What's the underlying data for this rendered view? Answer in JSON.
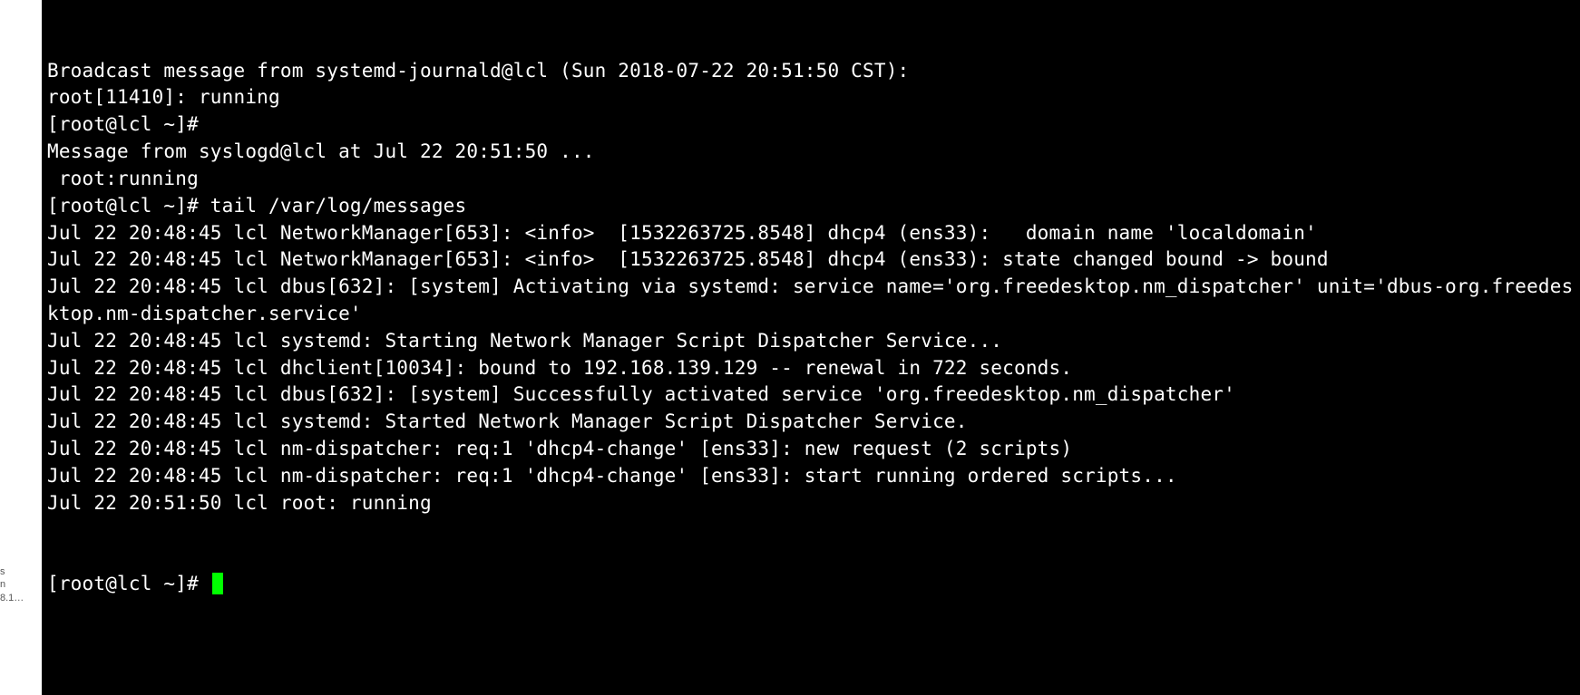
{
  "sidebar": {
    "fragment": "s\nn\n8.1…"
  },
  "terminal": {
    "lines": [
      "Broadcast message from systemd-journald@lcl (Sun 2018-07-22 20:51:50 CST):",
      "",
      "root[11410]: running",
      "",
      "[root@lcl ~]#",
      "Message from syslogd@lcl at Jul 22 20:51:50 ...",
      " root:running",
      "",
      "[root@lcl ~]# tail /var/log/messages",
      "Jul 22 20:48:45 lcl NetworkManager[653]: <info>  [1532263725.8548] dhcp4 (ens33):   domain name 'localdomain'",
      "Jul 22 20:48:45 lcl NetworkManager[653]: <info>  [1532263725.8548] dhcp4 (ens33): state changed bound -> bound",
      "Jul 22 20:48:45 lcl dbus[632]: [system] Activating via systemd: service name='org.freedesktop.nm_dispatcher' unit='dbus-org.freedesktop.nm-dispatcher.service'",
      "Jul 22 20:48:45 lcl systemd: Starting Network Manager Script Dispatcher Service...",
      "Jul 22 20:48:45 lcl dhclient[10034]: bound to 192.168.139.129 -- renewal in 722 seconds.",
      "Jul 22 20:48:45 lcl dbus[632]: [system] Successfully activated service 'org.freedesktop.nm_dispatcher'",
      "Jul 22 20:48:45 lcl systemd: Started Network Manager Script Dispatcher Service.",
      "Jul 22 20:48:45 lcl nm-dispatcher: req:1 'dhcp4-change' [ens33]: new request (2 scripts)",
      "Jul 22 20:48:45 lcl nm-dispatcher: req:1 'dhcp4-change' [ens33]: start running ordered scripts...",
      "Jul 22 20:51:50 lcl root: running"
    ],
    "prompt": "[root@lcl ~]# "
  }
}
